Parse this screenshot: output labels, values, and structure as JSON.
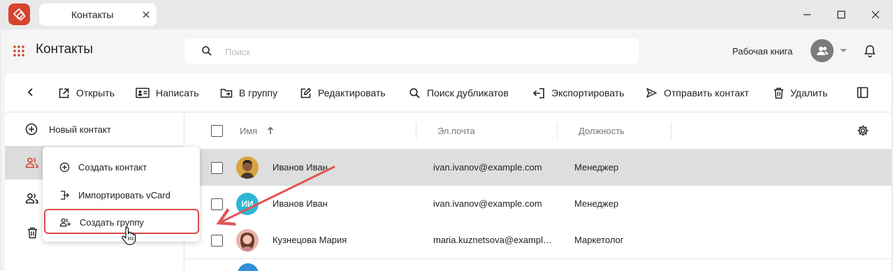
{
  "titlebar": {
    "tab_title": "Контакты"
  },
  "header": {
    "app_title": "Контакты",
    "search_placeholder": "Поиск",
    "address_book": "Рабочая книга"
  },
  "toolbar": {
    "items": [
      {
        "label": "Открыть",
        "icon": "open-external-icon"
      },
      {
        "label": "Написать",
        "icon": "contact-card-icon"
      },
      {
        "label": "В группу",
        "icon": "folder-move-icon"
      },
      {
        "label": "Редактировать",
        "icon": "edit-icon"
      },
      {
        "label": "Поиск дубликатов",
        "icon": "search-icon"
      },
      {
        "label": "Экспортировать",
        "icon": "export-icon"
      },
      {
        "label": "Отправить контакт",
        "icon": "send-icon"
      },
      {
        "label": "Удалить",
        "icon": "trash-icon"
      }
    ]
  },
  "sidebar": {
    "new_contact": "Новый контакт"
  },
  "table": {
    "columns": [
      "Имя",
      "Эл.почта",
      "Должность"
    ],
    "rows": [
      {
        "name": "Иванов Иван",
        "email": "ivan.ivanov@example.com",
        "position": "Менеджер",
        "avatar": "photo",
        "selected": true
      },
      {
        "name": "Иванов Иван",
        "email": "ivan.ivanov@example.com",
        "position": "Менеджер",
        "avatar": "ИИ",
        "avatar_color": "#2bb8d6",
        "selected": false
      },
      {
        "name": "Кузнецова Мария",
        "email": "maria.kuznetsova@exampl…",
        "position": "Маркетолог",
        "avatar": "photo",
        "selected": false
      }
    ]
  },
  "context_menu": {
    "items": [
      {
        "label": "Создать контакт",
        "icon": "plus-circle-icon"
      },
      {
        "label": "Импортировать vCard",
        "icon": "import-icon"
      },
      {
        "label": "Создать группу",
        "icon": "add-group-icon"
      }
    ]
  },
  "colors": {
    "accent": "#d7432f",
    "annotation": "#d94a4a",
    "selected_row": "#dedede"
  }
}
